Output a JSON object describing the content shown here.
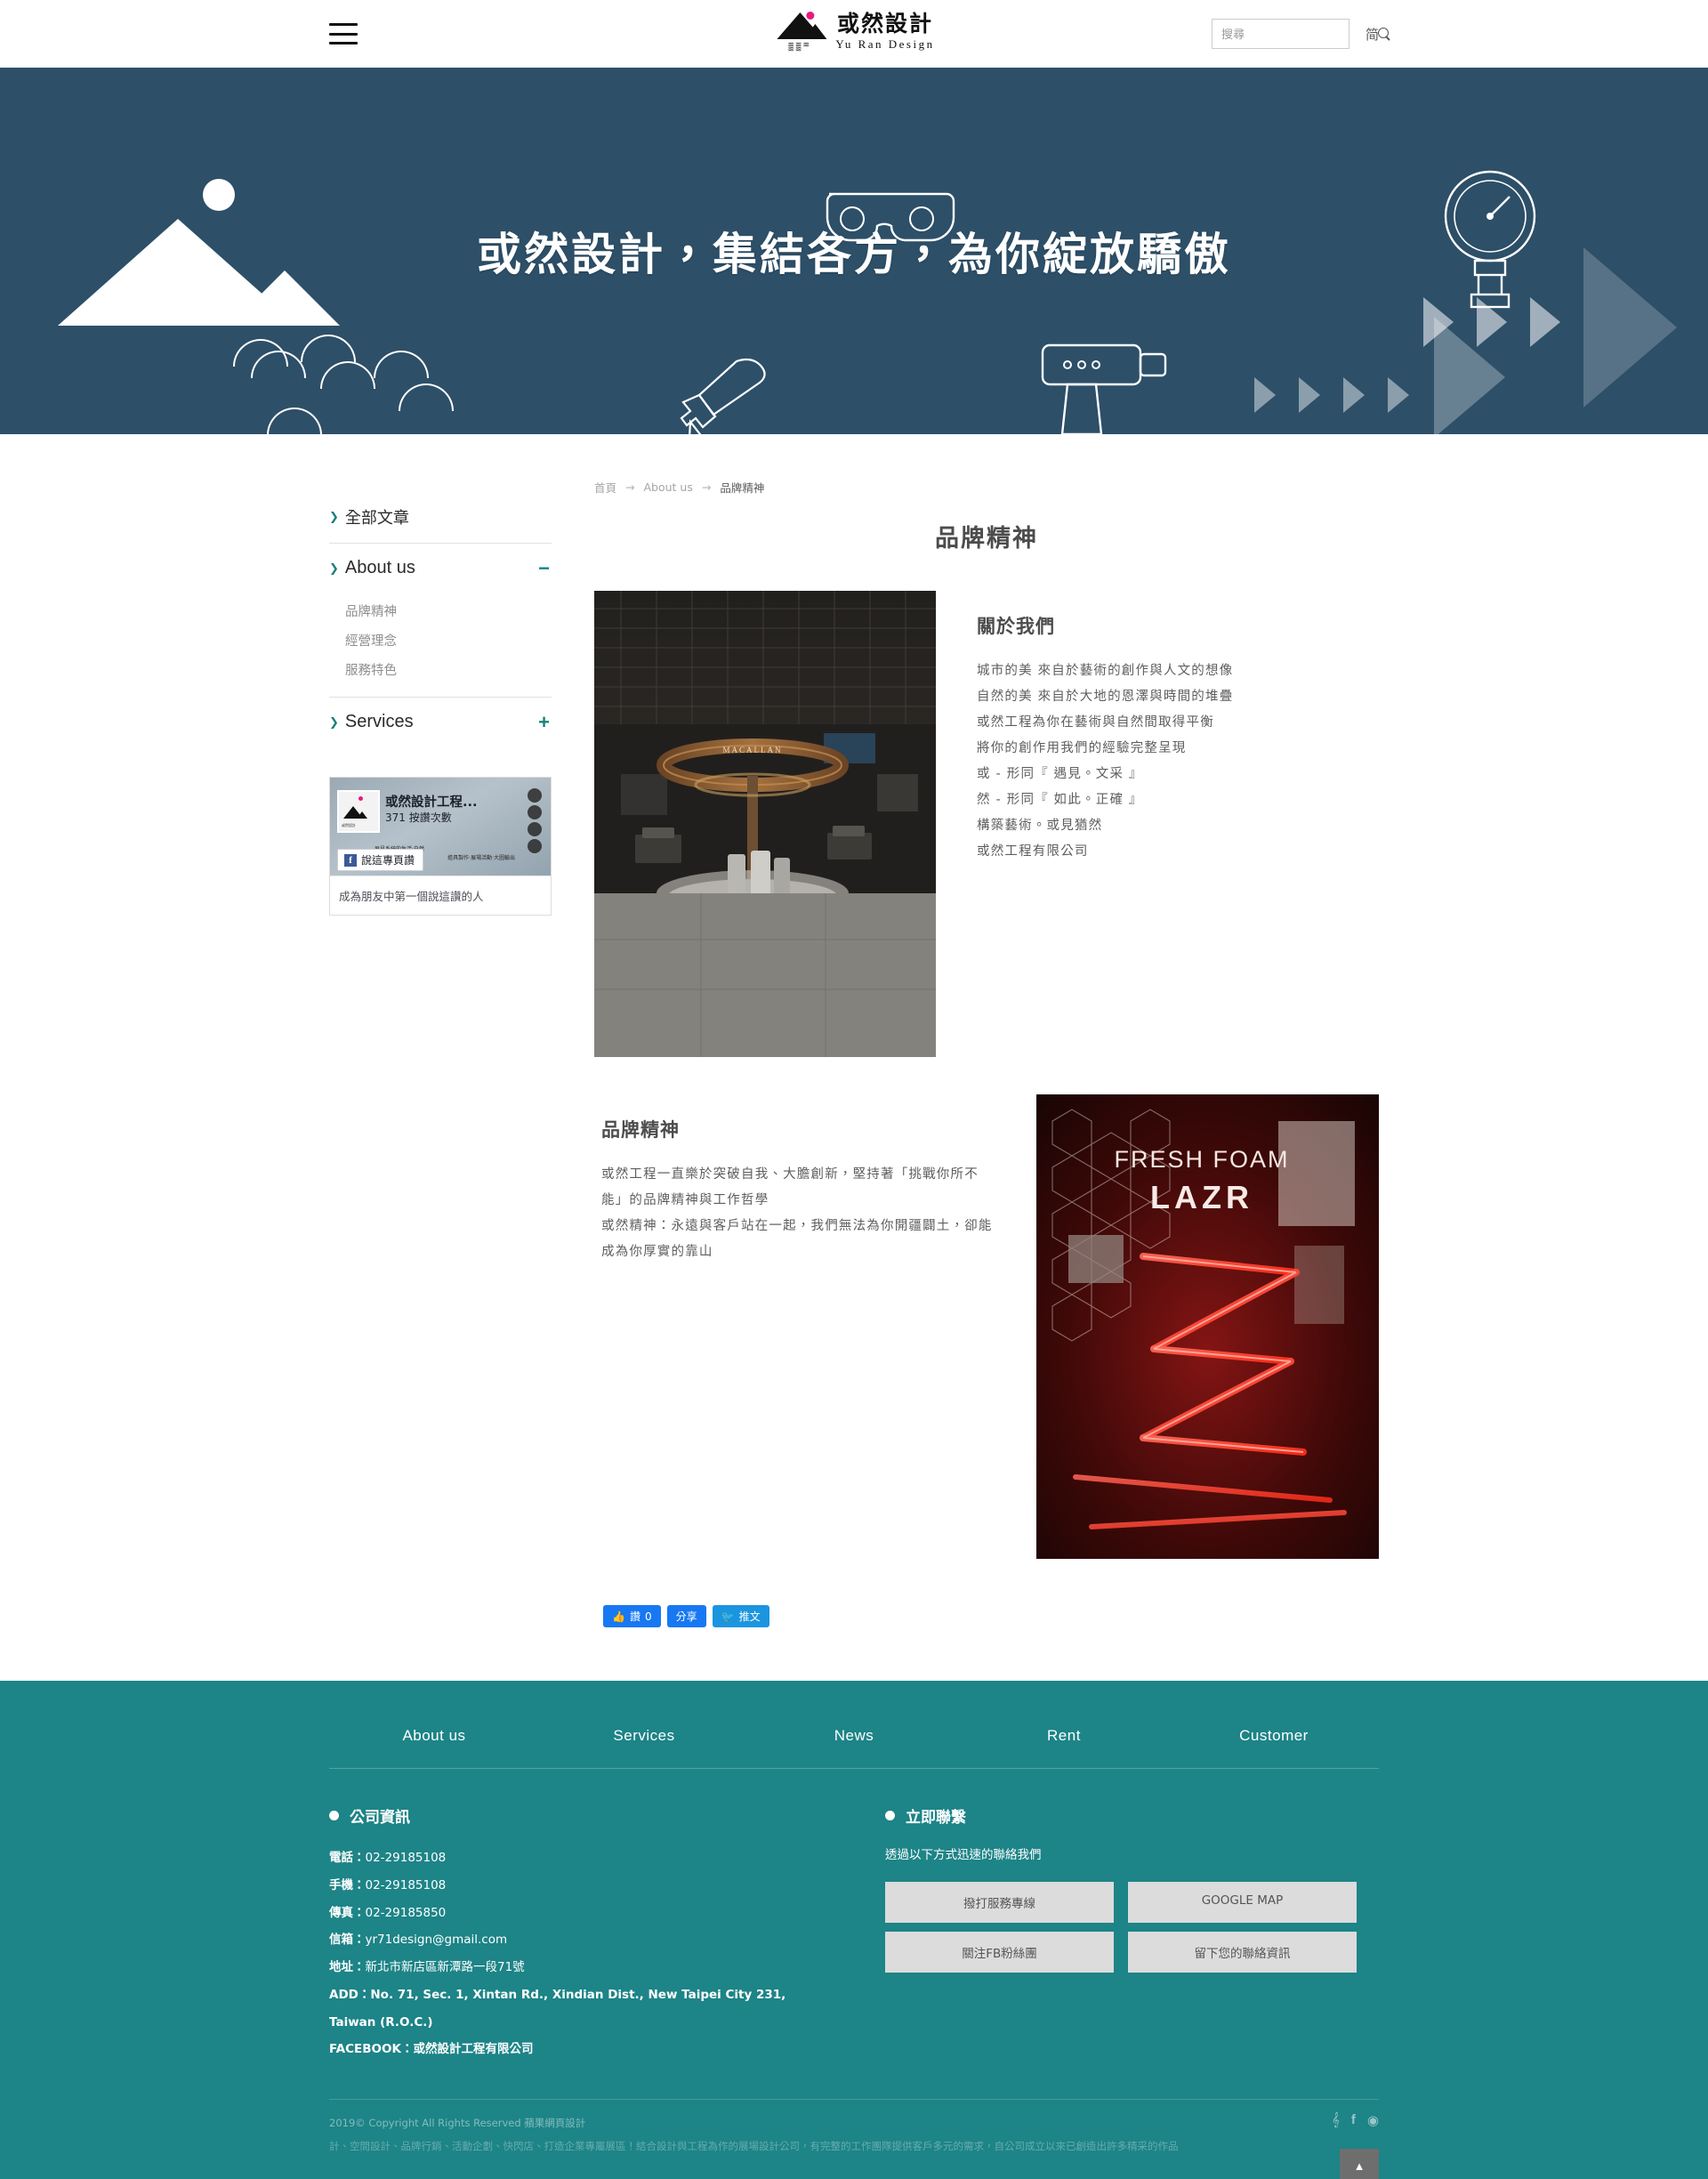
{
  "header": {
    "menu_icon": "hamburger-menu-icon",
    "logo_cn": "或然設計",
    "logo_en": "Yu Ran Design",
    "search_placeholder": "搜尋",
    "search_value": "",
    "search_icon": "search-icon",
    "lang_toggle": "简"
  },
  "hero": {
    "title": "或然設計，集結各方，為你綻放驕傲",
    "background_color": "#2d4f68"
  },
  "sidebar": {
    "items": [
      {
        "label": "全部文章",
        "toggle": ""
      },
      {
        "label": "About us",
        "toggle": "−"
      },
      {
        "label": "Services",
        "toggle": "+"
      }
    ],
    "about_sub_items": [
      "品牌精神",
      "經營理念",
      "服務特色"
    ],
    "fb_widget": {
      "page_name": "或然設計工程...",
      "likes": "371 按讚次數",
      "like_button": "說這專頁讚",
      "footer_text": "成為朋友中第一個說這讚的人",
      "cover_caption_left": "展見系統的生活‧自然",
      "cover_caption_right": "道具製作‧展場活動‧大圖輸出"
    }
  },
  "breadcrumb": {
    "items": [
      "首頁",
      "About us",
      "品牌精神"
    ],
    "separator": "→"
  },
  "page": {
    "title": "品牌精神"
  },
  "sections": [
    {
      "heading": "關於我們",
      "body": "城市的美 來自於藝術的創作與人文的想像\n自然的美 來自於大地的恩澤與時間的堆疊\n或然工程為你在藝術與自然間取得平衡\n將你的創作用我們的經驗完整呈現\n或 - 形同『 遇見。文采 』\n然 - 形同『 如此。正確 』\n構築藝術。或見猶然\n或然工程有限公司",
      "image_alt": "MACALLAN 展場空間實景"
    },
    {
      "heading": "品牌精神",
      "body": "或然工程一直樂於突破自我、大膽創新，堅持著「挑戰你所不能」的品牌精神與工作哲學\n或然精神：永遠與客戶站在一起，我們無法為你開疆闢土，卻能成為你厚實的靠山",
      "image_alt": "FRESH FOAM LAZR 霓虹展場"
    }
  ],
  "share": {
    "like_label": "讚",
    "like_count": "0",
    "share_label": "分享",
    "tweet_label": "推文"
  },
  "footer": {
    "nav": [
      "About us",
      "Services",
      "News",
      "Rent",
      "Customer"
    ],
    "company": {
      "heading": "公司資訊",
      "lines": [
        {
          "label": "電話：",
          "value": "02-29185108"
        },
        {
          "label": "手機：",
          "value": "02-29185108"
        },
        {
          "label": "傳真：",
          "value": "02-29185850"
        },
        {
          "label": "信箱：",
          "value": "yr71design@gmail.com"
        },
        {
          "label": "地址：",
          "value": "新北市新店區新潭路一段71號"
        },
        {
          "label": "ADD：",
          "value": "No. 71, Sec. 1, Xintan Rd., Xindian Dist., New Taipei City 231, Taiwan (R.O.C.)"
        },
        {
          "label": "FACEBOOK：",
          "value": "或然設計工程有限公司"
        }
      ]
    },
    "contact": {
      "heading": "立即聯繫",
      "subtitle": "透過以下方式迅速的聯絡我們",
      "buttons": [
        "撥打服務專線",
        "GOOGLE MAP",
        "關注FB粉絲團",
        "留下您的聯絡資訊"
      ]
    },
    "copyright": "2019© Copyright All Rights Reserved 蘋果網頁設計",
    "tagline": "計、空間設計、品牌行銷、活動企劃、快閃店、打造企業專屬展區！結合設計與工程為作的展場設計公司，有完整的工作團隊提供客戶多元的需求，自公司成立以來已創造出許多精采的作品",
    "social_icons": [
      "twitter-icon",
      "facebook-icon",
      "rss-icon"
    ],
    "back_to_top": "▲",
    "accent_color": "#1d8487"
  }
}
